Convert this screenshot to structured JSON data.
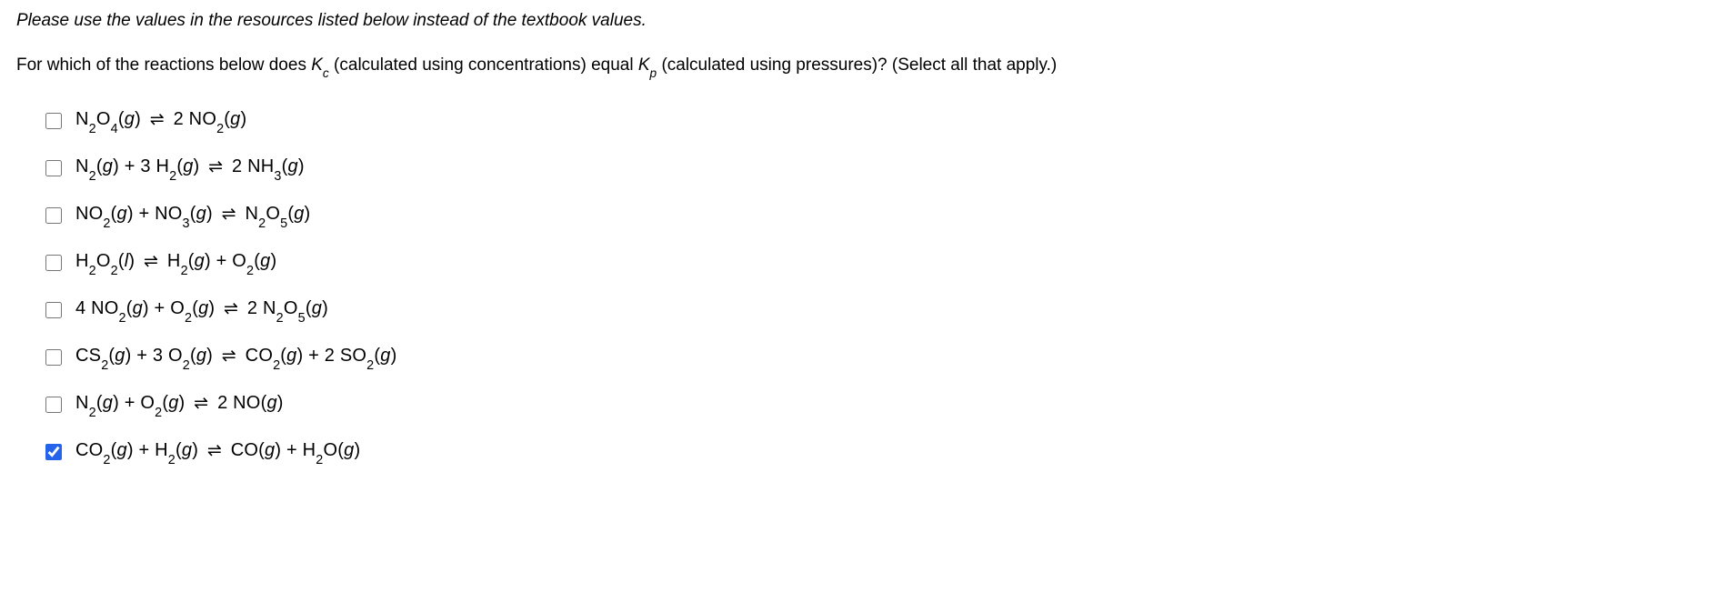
{
  "instruction_text": "Please use the values in the resources listed below instead of the textbook values.",
  "prompt": {
    "lead": "For which of the reactions below does ",
    "kc": "K",
    "kc_sub": "c",
    "kc_paren": " (calculated using concentrations) equal ",
    "kp": "K",
    "kp_sub": "p",
    "kp_paren": " (calculated using pressures)? (Select all that apply.)"
  },
  "options": [
    {
      "id": "reaction-1",
      "checked": false
    },
    {
      "id": "reaction-2",
      "checked": false
    },
    {
      "id": "reaction-3",
      "checked": false
    },
    {
      "id": "reaction-4",
      "checked": false
    },
    {
      "id": "reaction-5",
      "checked": false
    },
    {
      "id": "reaction-6",
      "checked": false
    },
    {
      "id": "reaction-7",
      "checked": false
    },
    {
      "id": "reaction-8",
      "checked": true
    }
  ],
  "glyphs": {
    "arrow": "⇌"
  },
  "eq": {
    "r1": {
      "a": "N",
      "a2": "2",
      "b": "O",
      "b4": "4",
      "gas": "g",
      "coef2": "2 ",
      "n": "NO",
      "n2": "2"
    },
    "r2": {
      "n": "N",
      "n2": "2",
      "plus": " + 3 ",
      "h": "H",
      "h2": "2",
      "rcoef": "2 ",
      "nh": "NH",
      "nh3": "3"
    },
    "r3": {
      "a": "NO",
      "a2": "2",
      "plus": " + ",
      "b": "NO",
      "b3": "3",
      "c": "N",
      "c2": "2",
      "d": "O",
      "d5": "5"
    },
    "r4": {
      "h": "H",
      "h2": "2",
      "o": "O",
      "o2": "2",
      "liq": "l",
      "r_h": "H",
      "r_h2": "2",
      "plus": " + ",
      "r_o": "O",
      "r_o2": "2"
    },
    "r5": {
      "coef4": "4 ",
      "no": "NO",
      "no2": "2",
      "plus": " + ",
      "o": "O",
      "o2": "2",
      "rcoef": "2 ",
      "n": "N",
      "n2": "2",
      "ro": "O",
      "ro5": "5"
    },
    "r6": {
      "cs": "CS",
      "cs2": "2",
      "plus": " + 3 ",
      "o": "O",
      "o2": "2",
      "co": "CO",
      "co2": "2",
      "rplus": " + 2 ",
      "so": "SO",
      "so2": "2"
    },
    "r7": {
      "n": "N",
      "n2": "2",
      "plus": " + ",
      "o": "O",
      "o2": "2",
      "rcoef": "2 ",
      "no": "NO"
    },
    "r8": {
      "co": "CO",
      "co2": "2",
      "plus": " + ",
      "h": "H",
      "h2": "2",
      "r_co": "CO",
      "rplus": " + ",
      "r_h": "H",
      "r_h2": "2",
      "r_o": "O"
    }
  }
}
